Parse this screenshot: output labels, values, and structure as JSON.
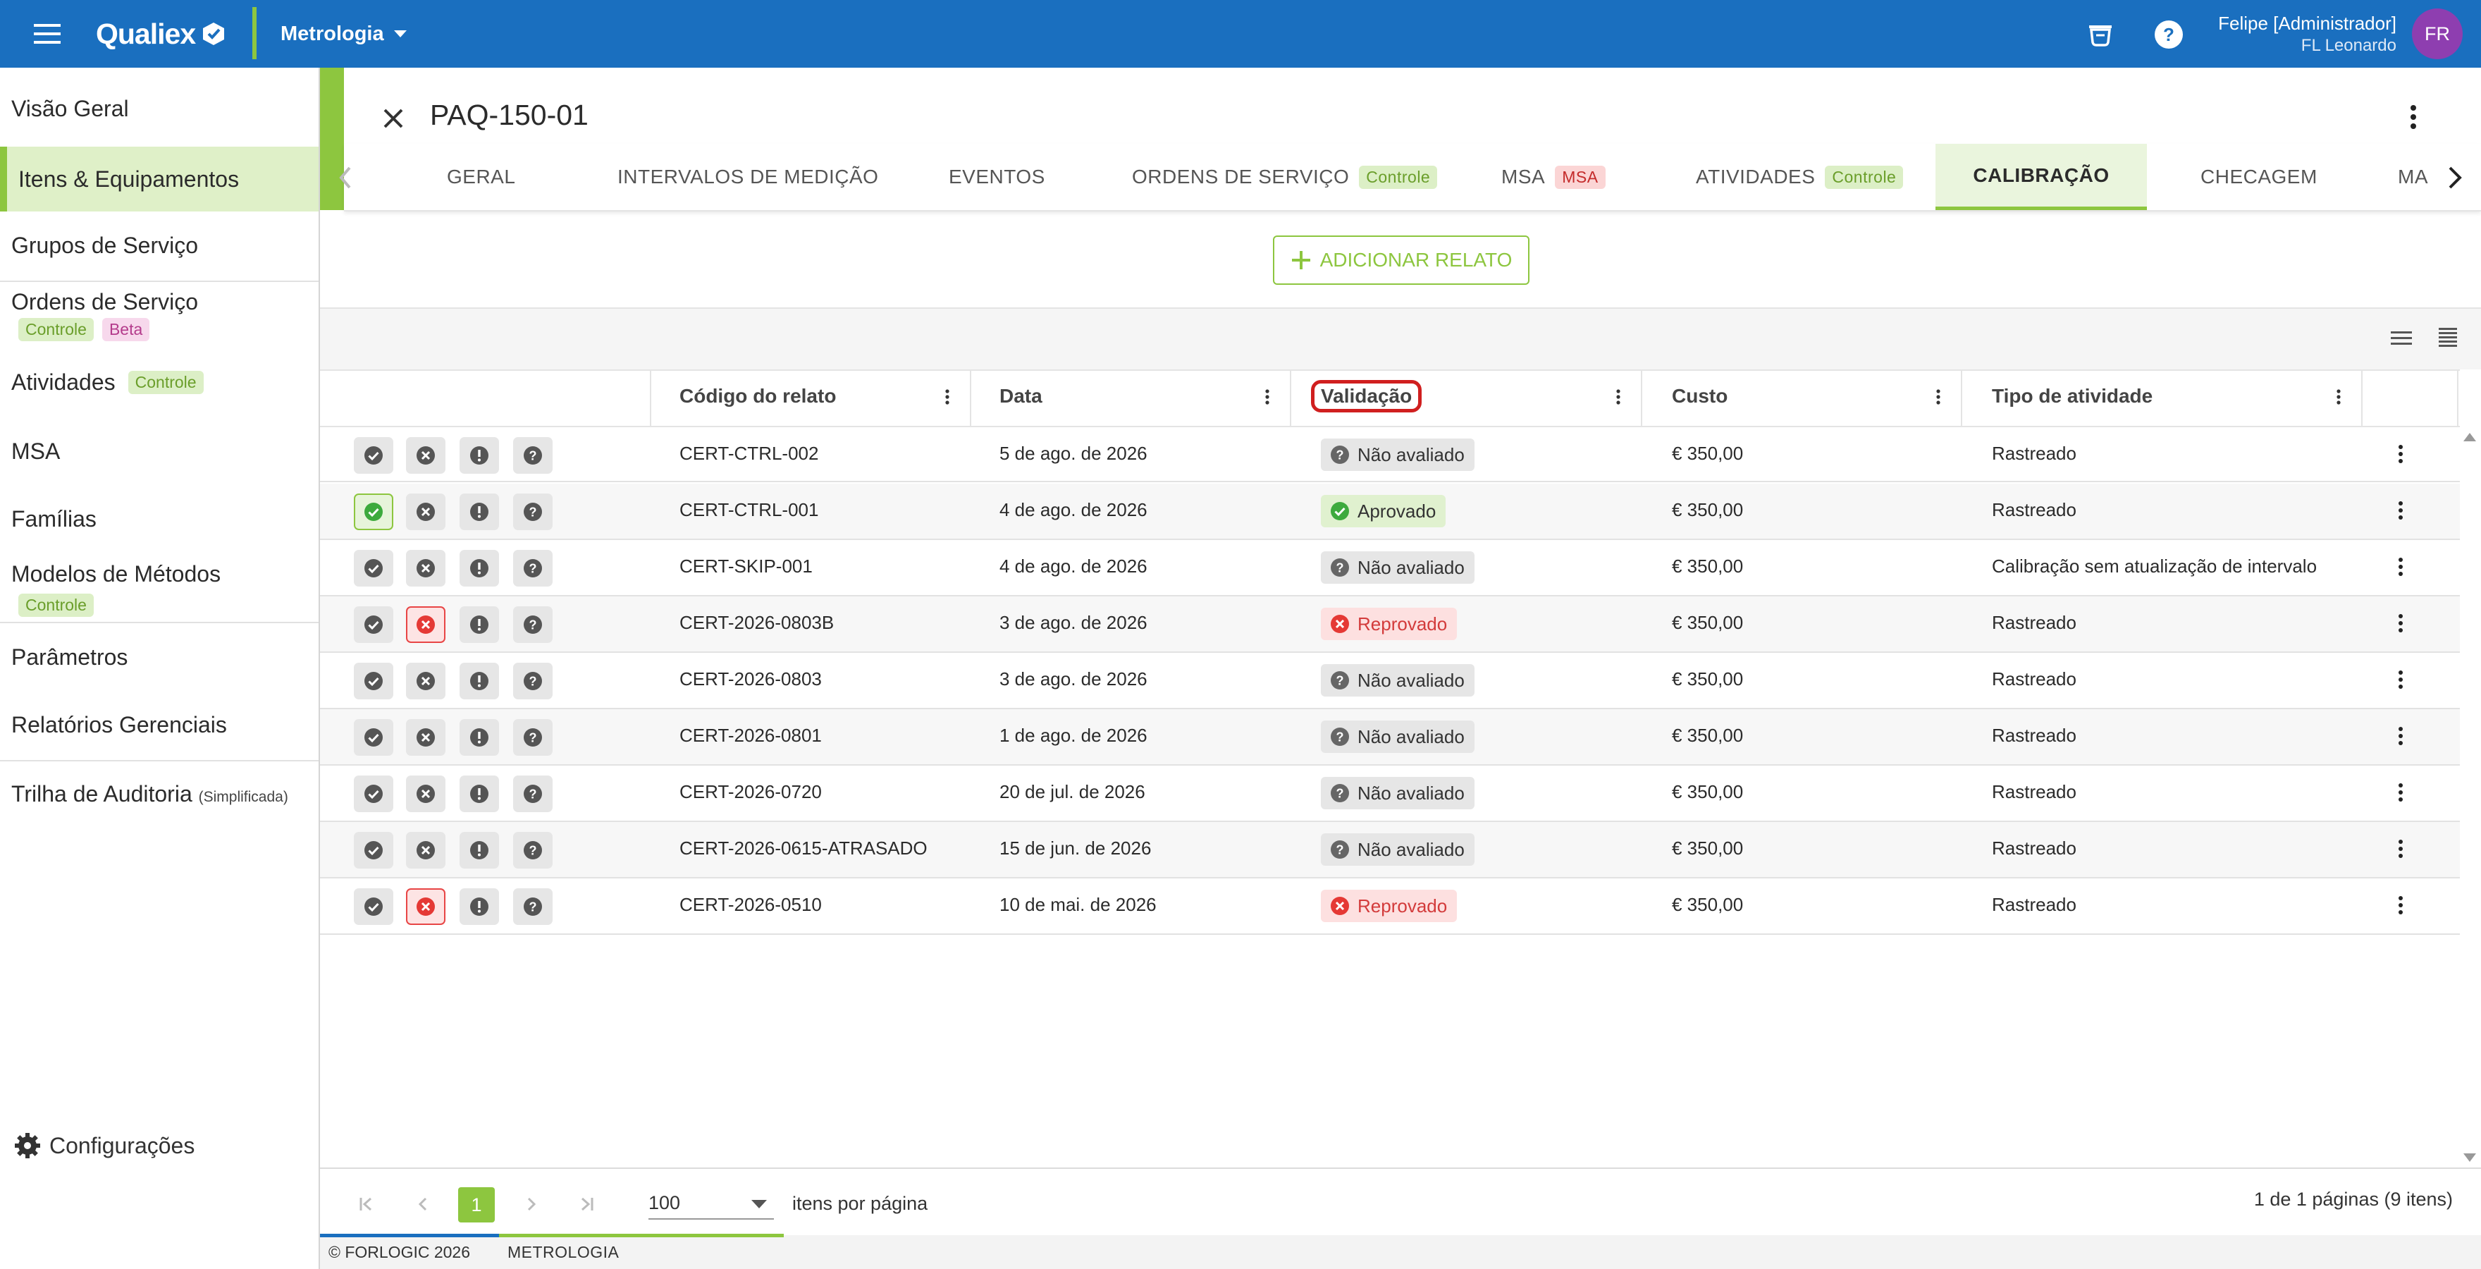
{
  "app": {
    "logo": "Qualiex",
    "module": "Metrologia",
    "user_name": "Felipe [Administrador]",
    "user_org": "FL Leonardo",
    "avatar_initials": "FR",
    "primary_color": "#1a6fbf",
    "accent_color": "#8dc63f"
  },
  "sidebar": {
    "items": [
      {
        "label": "Visão Geral"
      },
      {
        "label": "Itens & Equipamentos"
      },
      {
        "label": "Grupos de Serviço"
      },
      {
        "label": "Ordens de Serviço",
        "chips": [
          "Controle",
          "Beta"
        ]
      },
      {
        "label": "Atividades",
        "chips": [
          "Controle"
        ]
      },
      {
        "label": "MSA"
      },
      {
        "label": "Famílias"
      },
      {
        "label": "Modelos de Métodos",
        "chips": [
          "Controle"
        ]
      },
      {
        "label": "Parâmetros"
      },
      {
        "label": "Relatórios Gerenciais"
      },
      {
        "label": "Trilha de Auditoria",
        "suffix": "(Simplificada)"
      }
    ],
    "settings_label": "Configurações"
  },
  "record": {
    "title": "PAQ-150-01"
  },
  "tabs": [
    {
      "label": "GERAL"
    },
    {
      "label": "INTERVALOS DE MEDIÇÃO"
    },
    {
      "label": "EVENTOS"
    },
    {
      "label": "ORDENS DE SERVIÇO",
      "chip": "Controle"
    },
    {
      "label": "MSA",
      "chip": "MSA"
    },
    {
      "label": "ATIVIDADES",
      "chip": "Controle"
    },
    {
      "label": "CALIBRAÇÃO",
      "active": true
    },
    {
      "label": "CHECAGEM"
    },
    {
      "label": "MA"
    }
  ],
  "add_button": "ADICIONAR RELATO",
  "grid": {
    "columns": [
      "Código do relato",
      "Data",
      "Validação",
      "Custo",
      "Tipo de atividade"
    ],
    "rows": [
      {
        "code": "CERT-CTRL-002",
        "date": "5 de ago. de 2026",
        "validation": "Não avaliado",
        "status": "na",
        "cost": "€ 350,00",
        "activity": "Rastreado"
      },
      {
        "code": "CERT-CTRL-001",
        "date": "4 de ago. de 2026",
        "validation": "Aprovado",
        "status": "ok",
        "cost": "€ 350,00",
        "activity": "Rastreado"
      },
      {
        "code": "CERT-SKIP-001",
        "date": "4 de ago. de 2026",
        "validation": "Não avaliado",
        "status": "na",
        "cost": "€ 350,00",
        "activity": "Calibração sem atualização de intervalo"
      },
      {
        "code": "CERT-2026-0803B",
        "date": "3 de ago. de 2026",
        "validation": "Reprovado",
        "status": "bad",
        "cost": "€ 350,00",
        "activity": "Rastreado"
      },
      {
        "code": "CERT-2026-0803",
        "date": "3 de ago. de 2026",
        "validation": "Não avaliado",
        "status": "na",
        "cost": "€ 350,00",
        "activity": "Rastreado"
      },
      {
        "code": "CERT-2026-0801",
        "date": "1 de ago. de 2026",
        "validation": "Não avaliado",
        "status": "na",
        "cost": "€ 350,00",
        "activity": "Rastreado"
      },
      {
        "code": "CERT-2026-0720",
        "date": "20 de jul. de 2026",
        "validation": "Não avaliado",
        "status": "na",
        "cost": "€ 350,00",
        "activity": "Rastreado"
      },
      {
        "code": "CERT-2026-0615-ATRASADO",
        "date": "15 de jun. de 2026",
        "validation": "Não avaliado",
        "status": "na",
        "cost": "€ 350,00",
        "activity": "Rastreado"
      },
      {
        "code": "CERT-2026-0510",
        "date": "10 de mai. de 2026",
        "validation": "Reprovado",
        "status": "bad",
        "cost": "€ 350,00",
        "activity": "Rastreado"
      }
    ]
  },
  "pagination": {
    "current_page": "1",
    "page_size": "100",
    "page_size_label": "itens por página",
    "summary": "1 de 1 páginas (9 itens)"
  },
  "footer": {
    "copyright": "© FORLOGIC 2026",
    "module": "METROLOGIA"
  }
}
